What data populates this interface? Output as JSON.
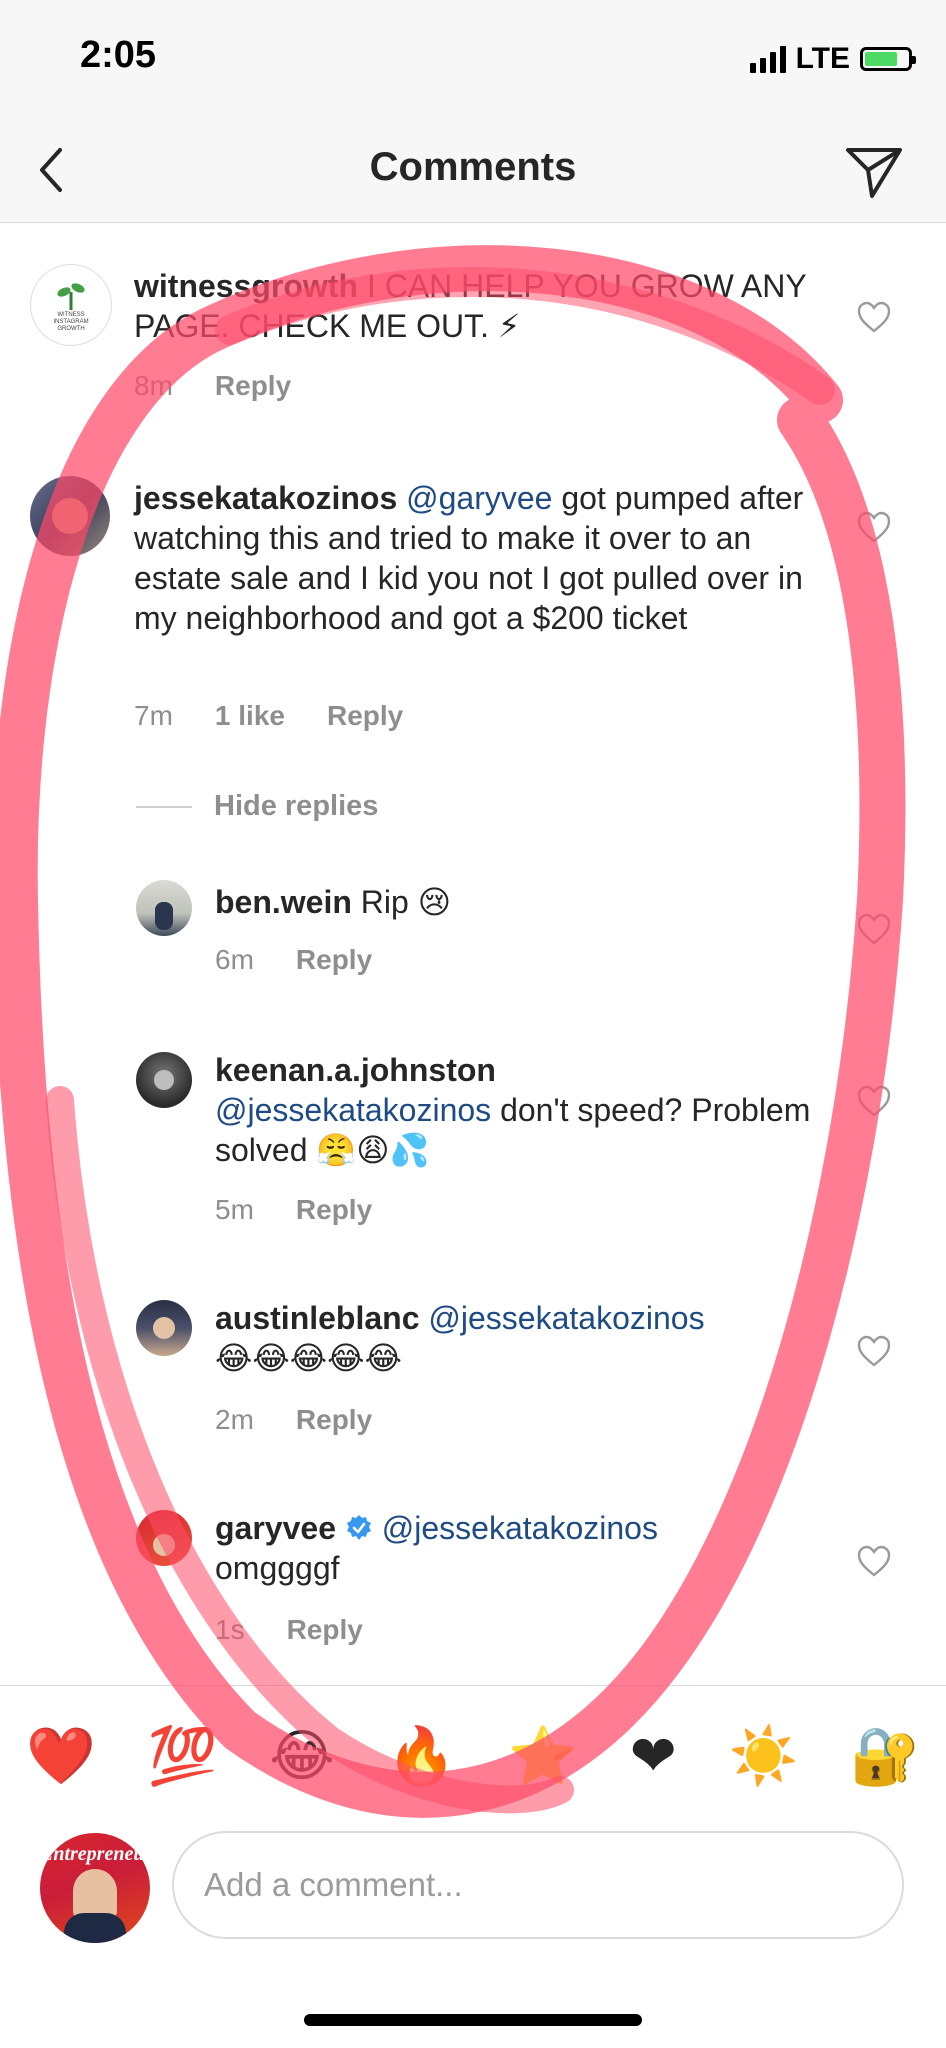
{
  "status": {
    "time": "2:05",
    "network": "LTE"
  },
  "nav": {
    "title": "Comments"
  },
  "comments": [
    {
      "username": "witnessgrowth",
      "avatar_text": "WITNESS INSTAGRAM GROWTH",
      "text": "I CAN HELP YOU GROW ANY PAGE. CHECK ME OUT. ⚡",
      "time": "8m",
      "reply": "Reply"
    },
    {
      "username": "jessekatakozinos",
      "mention": "@garyvee",
      "text": "got pumped after watching this and tried to make it over to an estate sale and I kid you not I got pulled over in my neighborhood and got a $200 ticket",
      "time": "7m",
      "likes": "1 like",
      "reply": "Reply"
    }
  ],
  "hide_replies": "Hide replies",
  "replies": [
    {
      "username": "ben.wein",
      "text": "Rip 😢",
      "time": "6m",
      "reply": "Reply"
    },
    {
      "username": "keenan.a.johnston",
      "mention": "@jessekatakozinos",
      "text": "don't speed? Problem solved 😤😩💦",
      "time": "5m",
      "reply": "Reply"
    },
    {
      "username": "austinleblanc",
      "mention": "@jessekatakozinos",
      "text": "😂😂😂😂😂",
      "time": "2m",
      "reply": "Reply"
    },
    {
      "username": "garyvee",
      "verified": true,
      "mention": "@jessekatakozinos",
      "text": "omggggf",
      "time": "1s",
      "reply": "Reply"
    }
  ],
  "emoji_bar": [
    "❤️",
    "💯",
    "😂",
    "🔥",
    "⭐",
    "❤",
    "☀️",
    "🔐"
  ],
  "compose": {
    "placeholder": "Add a comment...",
    "avatar_text": "Entrepreneur"
  },
  "colors": {
    "mention": "#1f4b85",
    "meta": "#8e8e8e",
    "scribble": "#ff4a68"
  }
}
